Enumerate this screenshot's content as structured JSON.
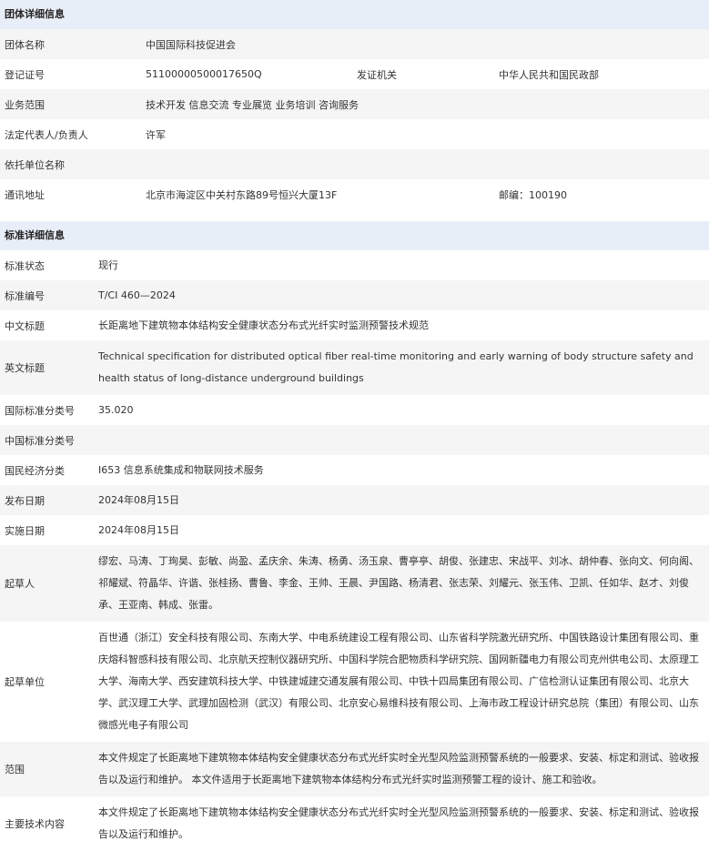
{
  "org": {
    "title": "团体详细信息",
    "name_label": "团体名称",
    "name": "中国国际科技促进会",
    "reg_label": "登记证号",
    "reg": "51100000500017650Q",
    "issuer_label": "发证机关",
    "issuer": "中华人民共和国民政部",
    "scope_label": "业务范围",
    "scope": "技术开发 信息交流 专业展览 业务培训 咨询服务",
    "rep_label": "法定代表人/负责人",
    "rep": "许军",
    "sponsor_label": "依托单位名称",
    "sponsor": "",
    "addr_label": "通讯地址",
    "addr": "北京市海淀区中关村东路89号恒兴大厦13F",
    "zip": "邮编：100190"
  },
  "std": {
    "title": "标准详细信息",
    "rows": [
      {
        "label": "标准状态",
        "value": "现行"
      },
      {
        "label": "标准编号",
        "value": "T/CI 460—2024"
      },
      {
        "label": "中文标题",
        "value": "长距离地下建筑物本体结构安全健康状态分布式光纤实时监测预警技术规范"
      },
      {
        "label": "英文标题",
        "value": "Technical specification for distributed optical fiber real-time monitoring and early warning of body structure safety and health status of long-distance underground buildings"
      },
      {
        "label": "国际标准分类号",
        "value": "35.020"
      },
      {
        "label": "中国标准分类号",
        "value": ""
      },
      {
        "label": "国民经济分类",
        "value": "I653 信息系统集成和物联网技术服务"
      },
      {
        "label": "发布日期",
        "value": "2024年08月15日"
      },
      {
        "label": "实施日期",
        "value": "2024年08月15日"
      },
      {
        "label": "起草人",
        "value": "缪宏、马涛、丁珣昊、彭敏、尚盈、孟庆余、朱涛、杨勇、汤玉泉、曹亭亭、胡俊、张建忠、宋战平、刘冰、胡仲春、张向文、何向阁、祁耀斌、符晶华、许谐、张桂扬、曹鲁、李金、王帅、王晨、尹国路、杨清君、张志荣、刘耀元、张玉伟、卫凯、任如华、赵才、刘俊承、王亚南、韩成、张雷。"
      },
      {
        "label": "起草单位",
        "value": "百世通（浙江）安全科技有限公司、东南大学、中电系统建设工程有限公司、山东省科学院激光研究所、中国铁路设计集团有限公司、重庆熔科智感科技有限公司、北京航天控制仪器研究所、中国科学院合肥物质科学研究院、国网新疆电力有限公司克州供电公司、太原理工大学、海南大学、西安建筑科技大学、中铁建城建交通发展有限公司、中铁十四局集团有限公司、广信检测认证集团有限公司、北京大学、武汉理工大学、武理加固检测（武汉）有限公司、北京安心易维科技有限公司、上海市政工程设计研究总院（集团）有限公司、山东微感光电子有限公司"
      },
      {
        "label": "范围",
        "value": "本文件规定了长距离地下建筑物本体结构安全健康状态分布式光纤实时全光型风险监测预警系统的一般要求、安装、标定和测试、验收报告以及运行和维护。 本文件适用于长距离地下建筑物本体结构分布式光纤实时监测预警工程的设计、施工和验收。"
      },
      {
        "label": "主要技术内容",
        "value": "本文件规定了长距离地下建筑物本体结构安全健康状态分布式光纤实时全光型风险监测预警系统的一般要求、安装、标定和测试、验收报告以及运行和维护。"
      }
    ]
  }
}
